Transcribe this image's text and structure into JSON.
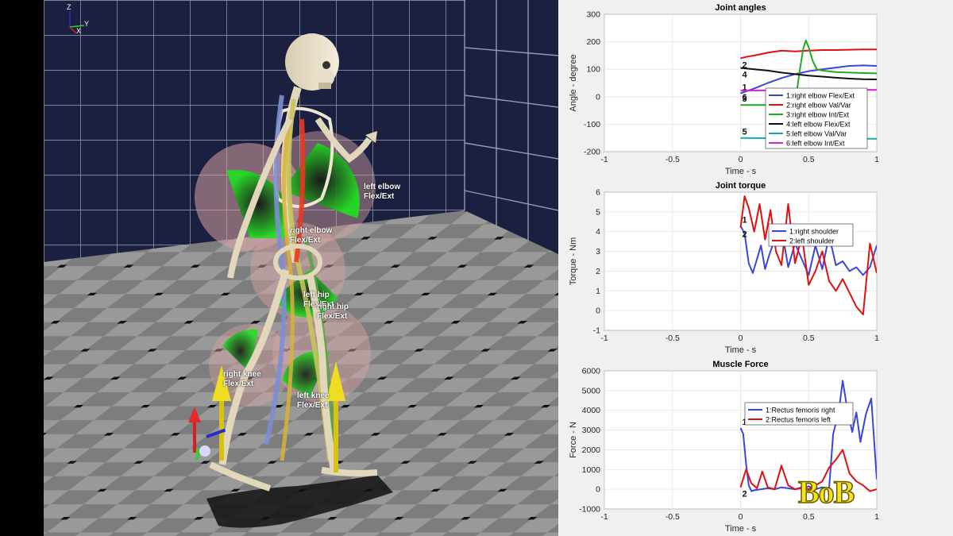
{
  "viewport": {
    "axis_indicator": {
      "z": "Z",
      "y": "Y",
      "x": "X"
    },
    "joint_labels": [
      {
        "id": "left-elbow",
        "text": "left elbow\nFlex/Ext"
      },
      {
        "id": "right-elbow",
        "text": "right elbow\nFlex/Ext"
      },
      {
        "id": "left-hip",
        "text": "left hip\nFlex/Ext"
      },
      {
        "id": "right-hip",
        "text": "right hip\nFlex/Ext"
      },
      {
        "id": "right-knee",
        "text": "right knee\nFlex/Ext"
      },
      {
        "id": "left-knee",
        "text": "left knee\nFlex/Ext"
      }
    ],
    "colors": {
      "wall": "#1b2040",
      "floor_light": "#8a8a8a",
      "floor_dark": "#5a5a5a",
      "gauge_green": "#1fe01f"
    }
  },
  "watermark": "BoB",
  "chart_data": [
    {
      "type": "line",
      "title": "Joint angles",
      "xlabel": "Time - s",
      "ylabel": "Angle - degree",
      "xlim": [
        -1,
        1
      ],
      "ylim": [
        -200,
        300
      ],
      "xticks": [
        -1,
        -0.5,
        0,
        0.5,
        1
      ],
      "yticks": [
        -200,
        -100,
        0,
        100,
        200,
        300
      ],
      "grid": true,
      "legend_position": "lower-right",
      "series": [
        {
          "label": "1",
          "name": "1:right elbow  Flex/Ext",
          "color": "#3a46d8",
          "x": [
            0,
            0.1,
            0.2,
            0.3,
            0.4,
            0.5,
            0.6,
            0.7,
            0.8,
            0.9,
            1.0
          ],
          "y": [
            12,
            30,
            50,
            68,
            82,
            93,
            100,
            106,
            112,
            114,
            112
          ]
        },
        {
          "label": "2",
          "name": "2:right elbow  Val/Var",
          "color": "#e01010",
          "x": [
            0,
            0.05,
            0.1,
            0.2,
            0.3,
            0.4,
            0.5,
            0.6,
            0.7,
            0.8,
            0.9,
            1.0
          ],
          "y": [
            140,
            146,
            150,
            160,
            168,
            165,
            168,
            170,
            170,
            171,
            172,
            172
          ]
        },
        {
          "label": "3",
          "name": "3:right elbow  Int/Ext",
          "color": "#22a822",
          "x": [
            0,
            0.1,
            0.2,
            0.3,
            0.4,
            0.43,
            0.46,
            0.48,
            0.5,
            0.53,
            0.56,
            0.6,
            0.7,
            0.8,
            0.9,
            1.0
          ],
          "y": [
            -30,
            -30,
            -30,
            -30,
            -30,
            80,
            175,
            205,
            180,
            130,
            100,
            95,
            90,
            88,
            86,
            85
          ]
        },
        {
          "label": "4",
          "name": "4:left elbow  Flex/Ext",
          "color": "#111111",
          "x": [
            0,
            0.1,
            0.2,
            0.3,
            0.4,
            0.5,
            0.6,
            0.7,
            0.8,
            0.9,
            1.0
          ],
          "y": [
            105,
            100,
            95,
            88,
            82,
            77,
            73,
            69,
            66,
            64,
            63
          ]
        },
        {
          "label": "5",
          "name": "5:left elbow  Val/Var",
          "color": "#1aa6b0",
          "x": [
            0,
            0.2,
            0.4,
            0.6,
            0.8,
            1.0
          ],
          "y": [
            -150,
            -151,
            -152,
            -152,
            -153,
            -153
          ]
        },
        {
          "label": "6",
          "name": "6:left elbow  Int/Ext",
          "color": "#e020d0",
          "x": [
            0,
            0.2,
            0.4,
            0.6,
            0.8,
            1.0
          ],
          "y": [
            22,
            23,
            24,
            25,
            25,
            25
          ]
        }
      ]
    },
    {
      "type": "line",
      "title": "Joint torque",
      "xlabel": "Time - s",
      "ylabel": "Torque - Nm",
      "xlim": [
        -1,
        1
      ],
      "ylim": [
        -1,
        6
      ],
      "xticks": [
        -1,
        -0.5,
        0,
        0.5,
        1
      ],
      "yticks": [
        -1,
        0,
        1,
        2,
        3,
        4,
        5,
        6
      ],
      "grid": true,
      "legend_position": "upper-right",
      "series": [
        {
          "label": "1",
          "name": "1:right shoulder",
          "color": "#3a46d8",
          "x": [
            0,
            0.03,
            0.06,
            0.09,
            0.12,
            0.15,
            0.18,
            0.21,
            0.25,
            0.3,
            0.35,
            0.4,
            0.45,
            0.5,
            0.55,
            0.6,
            0.65,
            0.7,
            0.75,
            0.8,
            0.85,
            0.9,
            0.95,
            1.0
          ],
          "y": [
            4.3,
            3.9,
            2.4,
            1.9,
            2.6,
            3.3,
            2.1,
            2.8,
            3.6,
            4.2,
            2.2,
            3.4,
            2.6,
            1.8,
            3.3,
            2.1,
            3.8,
            2.3,
            2.5,
            2.0,
            2.2,
            1.8,
            2.2,
            3.3
          ]
        },
        {
          "label": "2",
          "name": "2:left shoulder",
          "color": "#e01010",
          "x": [
            0,
            0.03,
            0.06,
            0.1,
            0.14,
            0.18,
            0.22,
            0.26,
            0.3,
            0.35,
            0.4,
            0.45,
            0.5,
            0.55,
            0.6,
            0.65,
            0.7,
            0.75,
            0.8,
            0.85,
            0.9,
            0.95,
            1.0
          ],
          "y": [
            4.2,
            5.8,
            5.2,
            4.0,
            5.4,
            3.6,
            5.1,
            3.0,
            2.3,
            5.4,
            2.4,
            3.8,
            1.3,
            2.0,
            3.0,
            1.5,
            1.0,
            1.6,
            0.9,
            0.2,
            -0.2,
            3.4,
            1.9
          ]
        }
      ]
    },
    {
      "type": "line",
      "title": "Muscle Force",
      "xlabel": "Time - s",
      "ylabel": "Force - N",
      "xlim": [
        -1,
        1
      ],
      "ylim": [
        -1000,
        6000
      ],
      "xticks": [
        -1,
        -0.5,
        0,
        0.5,
        1
      ],
      "yticks": [
        -1000,
        0,
        1000,
        2000,
        3000,
        4000,
        5000,
        6000
      ],
      "grid": true,
      "legend_position": "upper-right",
      "series": [
        {
          "label": "1",
          "name": "1:Rectus femoris right",
          "color": "#3a46d8",
          "x": [
            0,
            0.02,
            0.04,
            0.06,
            0.08,
            0.1,
            0.15,
            0.2,
            0.25,
            0.3,
            0.35,
            0.4,
            0.45,
            0.5,
            0.55,
            0.6,
            0.65,
            0.68,
            0.72,
            0.75,
            0.78,
            0.82,
            0.85,
            0.88,
            0.92,
            0.96,
            1.0
          ],
          "y": [
            3100,
            2800,
            1300,
            200,
            -100,
            -50,
            0,
            50,
            0,
            100,
            50,
            0,
            50,
            150,
            0,
            100,
            50,
            2800,
            3900,
            5500,
            4200,
            2900,
            3900,
            2400,
            3800,
            4600,
            500
          ]
        },
        {
          "label": "2",
          "name": "2:Rectus femoris left",
          "color": "#e01010",
          "x": [
            0,
            0.04,
            0.08,
            0.12,
            0.16,
            0.2,
            0.25,
            0.3,
            0.35,
            0.4,
            0.45,
            0.5,
            0.55,
            0.6,
            0.65,
            0.7,
            0.75,
            0.8,
            0.85,
            0.9,
            0.95,
            1.0
          ],
          "y": [
            100,
            1000,
            300,
            50,
            900,
            100,
            0,
            1200,
            200,
            0,
            100,
            0,
            200,
            400,
            1100,
            1500,
            2000,
            800,
            400,
            200,
            -100,
            0
          ]
        }
      ]
    }
  ]
}
